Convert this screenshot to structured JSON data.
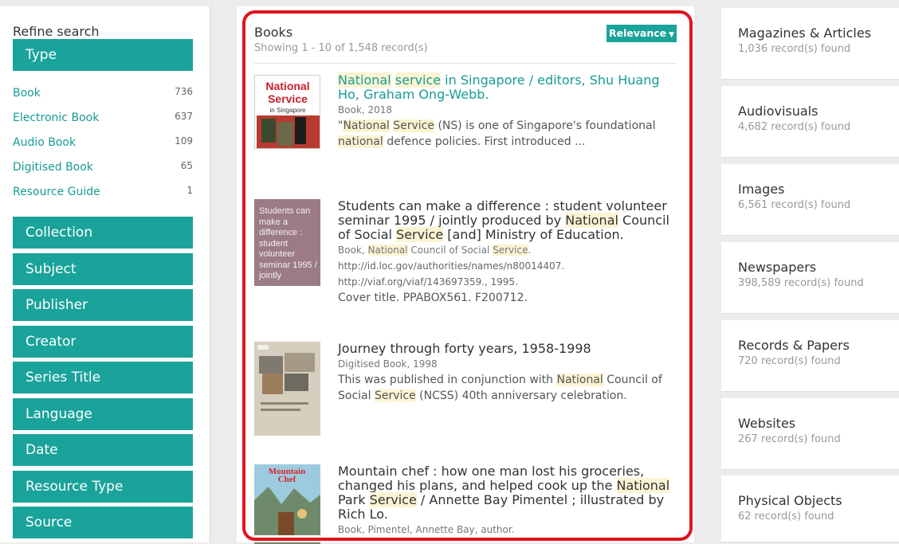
{
  "left": {
    "refine_title": "Refine search",
    "type_header": "Type",
    "type_items": [
      {
        "label": "Book",
        "count": "736"
      },
      {
        "label": "Electronic Book",
        "count": "637"
      },
      {
        "label": "Audio Book",
        "count": "109"
      },
      {
        "label": "Digitised Book",
        "count": "65"
      },
      {
        "label": "Resource Guide",
        "count": "1"
      }
    ],
    "facets": [
      "Collection",
      "Subject",
      "Publisher",
      "Creator",
      "Series Title",
      "Language",
      "Date",
      "Resource Type",
      "Source"
    ]
  },
  "center": {
    "title": "Books",
    "subtitle": "Showing 1 - 10 of 1,548 record(s)",
    "sort_label": "Relevance",
    "results": [
      {
        "title_parts": [
          "National",
          " ",
          "service",
          " in Singapore / editors, Shu Huang Ho, Graham Ong-Webb."
        ],
        "meta": "Book, 2018",
        "desc_parts": [
          "\"",
          "National",
          " ",
          "Service",
          " (NS) is one of Singapore's foundational ",
          "national",
          " defence policies. First introduced ..."
        ],
        "thumb_text": [
          "National",
          "Service",
          "in Singapore"
        ]
      },
      {
        "title_parts": [
          "Students can make a difference : student volunteer seminar 1995 / jointly produced by ",
          "National",
          " Council of Social ",
          "Service",
          " [and] Ministry of Education."
        ],
        "meta_parts": [
          "Book, ",
          "National",
          " Council of Social ",
          "Service",
          "."
        ],
        "url1": "http://id.loc.gov/authorities/names/n80014407.",
        "url2": "http://viaf.org/viaf/143697359., 1995.",
        "desc": "Cover title. PPABOX561. F200712.",
        "thumb_text": "Students can make a difference : student volunteer seminar 1995 / jointly"
      },
      {
        "title": "Journey through forty years, 1958-1998",
        "meta": "Digitised Book, 1998",
        "desc_parts": [
          "This was published in conjunction with ",
          "National",
          " Council of Social ",
          "Service",
          " (NCSS) 40th anniversary celebration."
        ]
      },
      {
        "title_parts": [
          "Mountain chef : how one man lost his groceries, changed his plans, and helped cook up the ",
          "National",
          " Park ",
          "Service",
          " / Annette Bay Pimentel ; illustrated by Rich Lo."
        ],
        "meta": "Book, Pimentel, Annette Bay, author.",
        "thumb_text": [
          "Mountain",
          "Chef"
        ]
      }
    ]
  },
  "right": {
    "cards": [
      {
        "title": "Magazines & Articles",
        "count": "1,036 record(s) found"
      },
      {
        "title": "Audiovisuals",
        "count": "4,682 record(s) found"
      },
      {
        "title": "Images",
        "count": "6,561 record(s) found"
      },
      {
        "title": "Newspapers",
        "count": "398,589 record(s) found"
      },
      {
        "title": "Records & Papers",
        "count": "720 record(s) found"
      },
      {
        "title": "Websites",
        "count": "267 record(s) found"
      },
      {
        "title": "Physical Objects",
        "count": "62 record(s) found"
      }
    ]
  },
  "colors": {
    "accent": "#1aa39a",
    "highlight": "#fbf4d2",
    "frame": "#e0141e"
  }
}
